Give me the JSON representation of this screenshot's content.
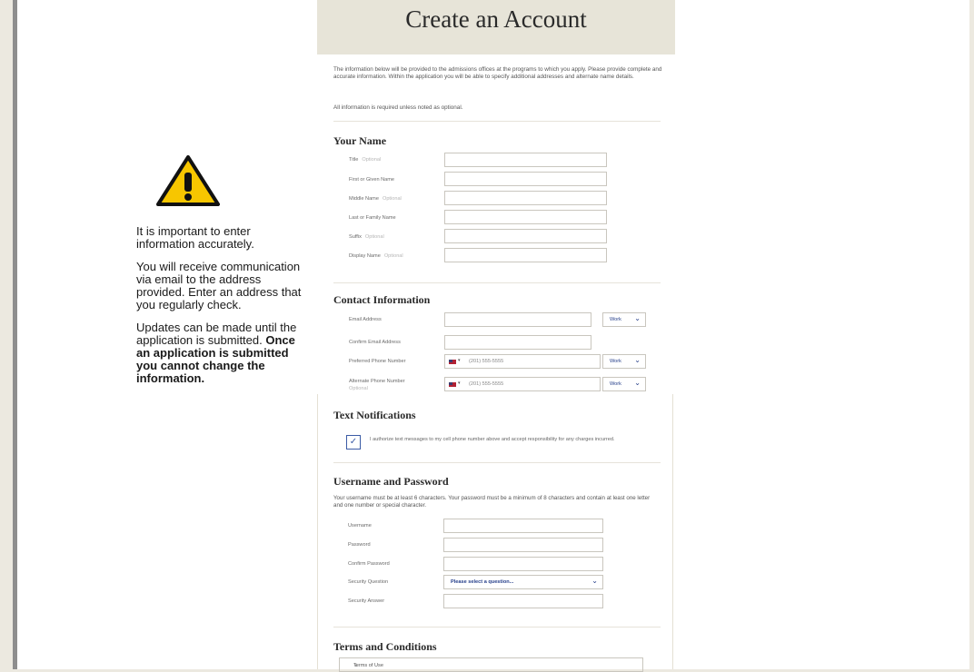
{
  "title": "Create an Account",
  "intro": "The information below will be provided to the admissions offices at the programs to which you apply. Please provide complete and accurate information. Within the application you will be able to specify additional addresses and alternate name details.",
  "required_note": "All information is required unless noted as optional.",
  "optional_tag": "Optional",
  "sidebar": {
    "p1": "It is important to enter information accurately.",
    "p2": "You will receive communication via email to the address provided. Enter an address that you regularly check.",
    "p3_plain": "Updates can be made until the application is submitted. ",
    "p3_bold": "Once an application is submitted you cannot change the information."
  },
  "your_name": {
    "heading": "Your Name",
    "fields": [
      {
        "label": "Title",
        "optional": true
      },
      {
        "label": "First or Given Name",
        "optional": false
      },
      {
        "label": "Middle Name",
        "optional": true
      },
      {
        "label": "Last or Family Name",
        "optional": false
      },
      {
        "label": "Suffix",
        "optional": true
      },
      {
        "label": "Display Name",
        "optional": true
      }
    ]
  },
  "contact": {
    "heading": "Contact Information",
    "email_label": "Email Address",
    "email_type": "Work",
    "confirm_email_label": "Confirm Email Address",
    "preferred_phone_label": "Preferred Phone Number",
    "preferred_phone_placeholder": "(201) 555-5555",
    "preferred_phone_type": "Work",
    "alternate_phone_label": "Alternate Phone Number",
    "alternate_phone_placeholder": "(201) 555-5555",
    "alternate_phone_type": "Work"
  },
  "text_notifications": {
    "heading": "Text Notifications",
    "consent": "I authorize text messages to my cell phone number above and accept responsibility for any charges incurred.",
    "checked": true
  },
  "credentials": {
    "heading": "Username and Password",
    "note": "Your username must be at least 6 characters. Your password must be a minimum of 8 characters and contain at least one letter and one number or special character.",
    "username_label": "Username",
    "password_label": "Password",
    "confirm_password_label": "Confirm Password",
    "security_question_label": "Security Question",
    "security_question_value": "Please select a question...",
    "security_answer_label": "Security Answer"
  },
  "terms": {
    "heading": "Terms and Conditions",
    "box_text": "Terms of Use"
  },
  "colors": {
    "header_band": "#e7e4d8",
    "accent_blue": "#27408b",
    "warning_yellow": "#f7c600"
  }
}
